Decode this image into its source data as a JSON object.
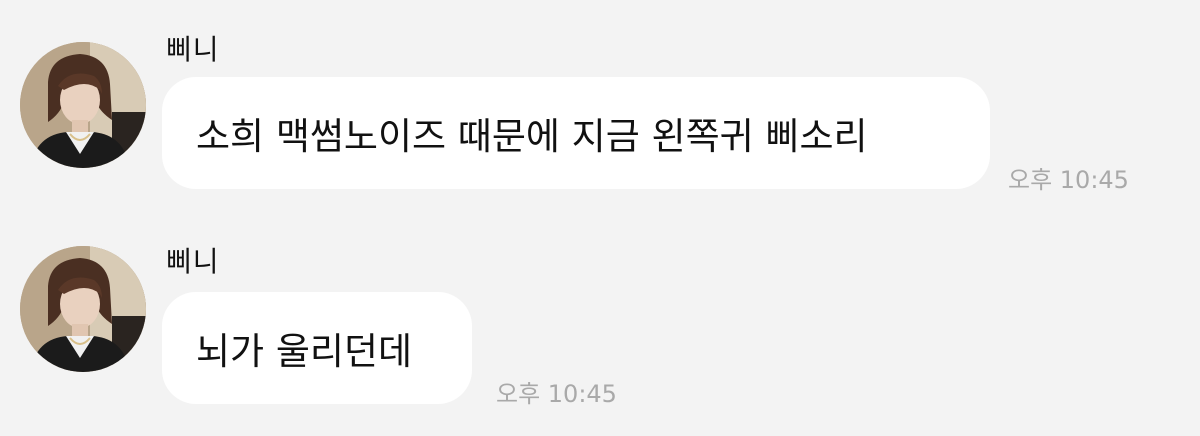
{
  "messages": [
    {
      "sender": "삐니",
      "text": "소희 맥썸노이즈 때문에 지금 왼쪽귀 삐소리",
      "time": "오후 10:45",
      "avatar": "profile-photo"
    },
    {
      "sender": "삐니",
      "text": "뇌가 울리던데",
      "time": "오후 10:45",
      "avatar": "profile-photo"
    }
  ],
  "colors": {
    "background": "#f3f3f3",
    "bubble": "#ffffff",
    "text": "#111111",
    "timestamp": "#a9a9a9"
  }
}
